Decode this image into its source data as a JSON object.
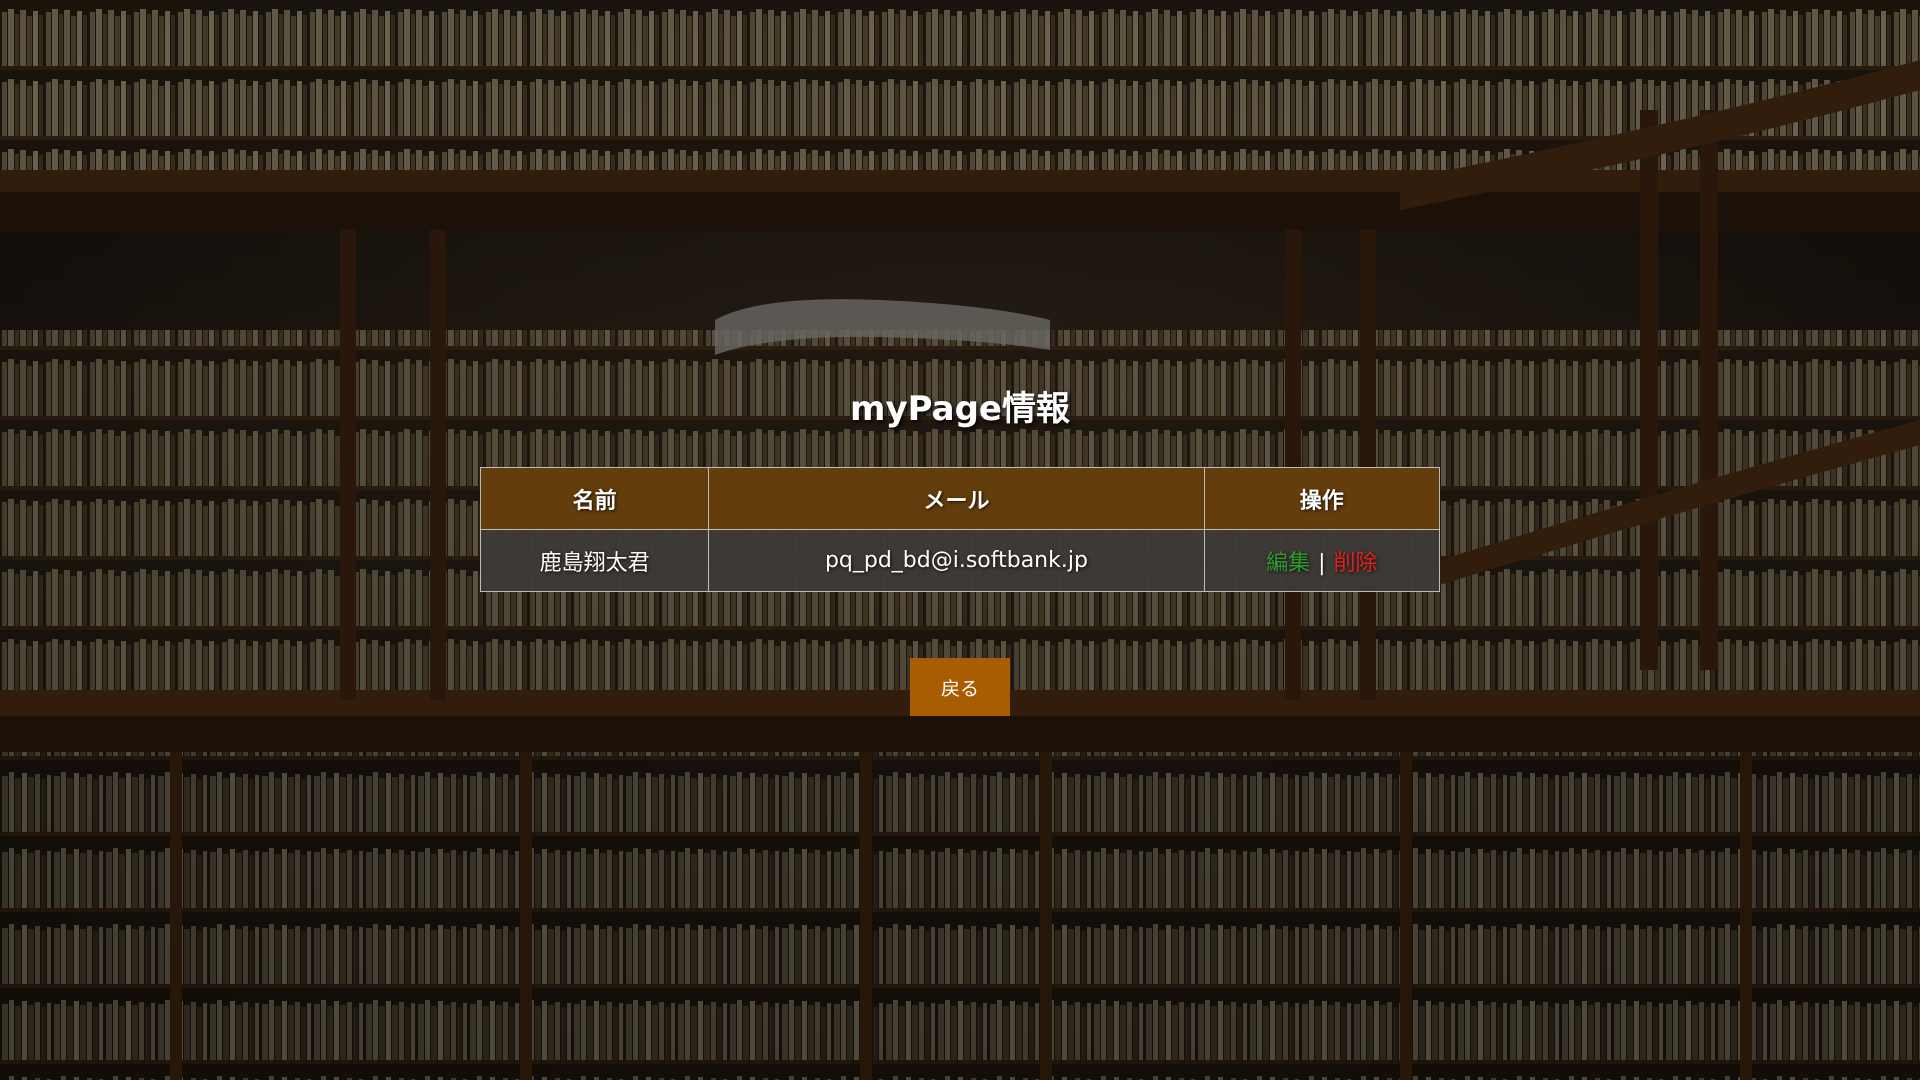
{
  "page": {
    "title": "myPage情報"
  },
  "table": {
    "headers": {
      "name": "名前",
      "email": "メール",
      "actions": "操作"
    },
    "rows": [
      {
        "name": "鹿島翔太君",
        "email": "pq_pd_bd@i.softbank.jp",
        "edit_label": "編集",
        "separator": "|",
        "delete_label": "削除"
      }
    ]
  },
  "back_button": {
    "label": "戻る"
  },
  "colors": {
    "header_bg": "#633d0c",
    "row_bg": "#3e3a37",
    "edit_link": "#2e9b2e",
    "delete_link": "#e0201c",
    "button_bg": "#a85d00"
  },
  "background": {
    "image": "library-bookshelves-background"
  }
}
